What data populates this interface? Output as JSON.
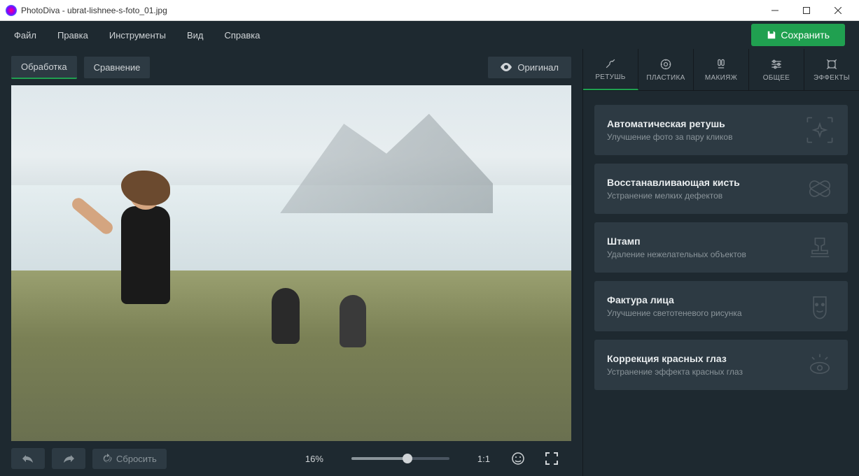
{
  "titlebar": {
    "text": "PhotoDiva - ubrat-lishnee-s-foto_01.jpg"
  },
  "menu": {
    "file": "Файл",
    "edit": "Правка",
    "tools": "Инструменты",
    "view": "Вид",
    "help": "Справка",
    "save": "Сохранить"
  },
  "canvasTabs": {
    "process": "Обработка",
    "compare": "Сравнение",
    "original": "Оригинал"
  },
  "bottom": {
    "reset": "Сбросить",
    "zoom": "16%",
    "ratio": "1:1"
  },
  "toolTabs": {
    "retouch": "РЕТУШЬ",
    "liquify": "ПЛАСТИКА",
    "makeup": "МАКИЯЖ",
    "general": "ОБЩЕЕ",
    "effects": "ЭФФЕКТЫ"
  },
  "cards": {
    "auto": {
      "title": "Автоматическая ретушь",
      "desc": "Улучшение фото за пару кликов"
    },
    "heal": {
      "title": "Восстанавливающая кисть",
      "desc": "Устранение мелких дефектов"
    },
    "stamp": {
      "title": "Штамп",
      "desc": "Удаление нежелательных объектов"
    },
    "texture": {
      "title": "Фактура лица",
      "desc": "Улучшение светотеневого рисунка"
    },
    "redeye": {
      "title": "Коррекция красных глаз",
      "desc": "Устранение эффекта красных глаз"
    }
  }
}
